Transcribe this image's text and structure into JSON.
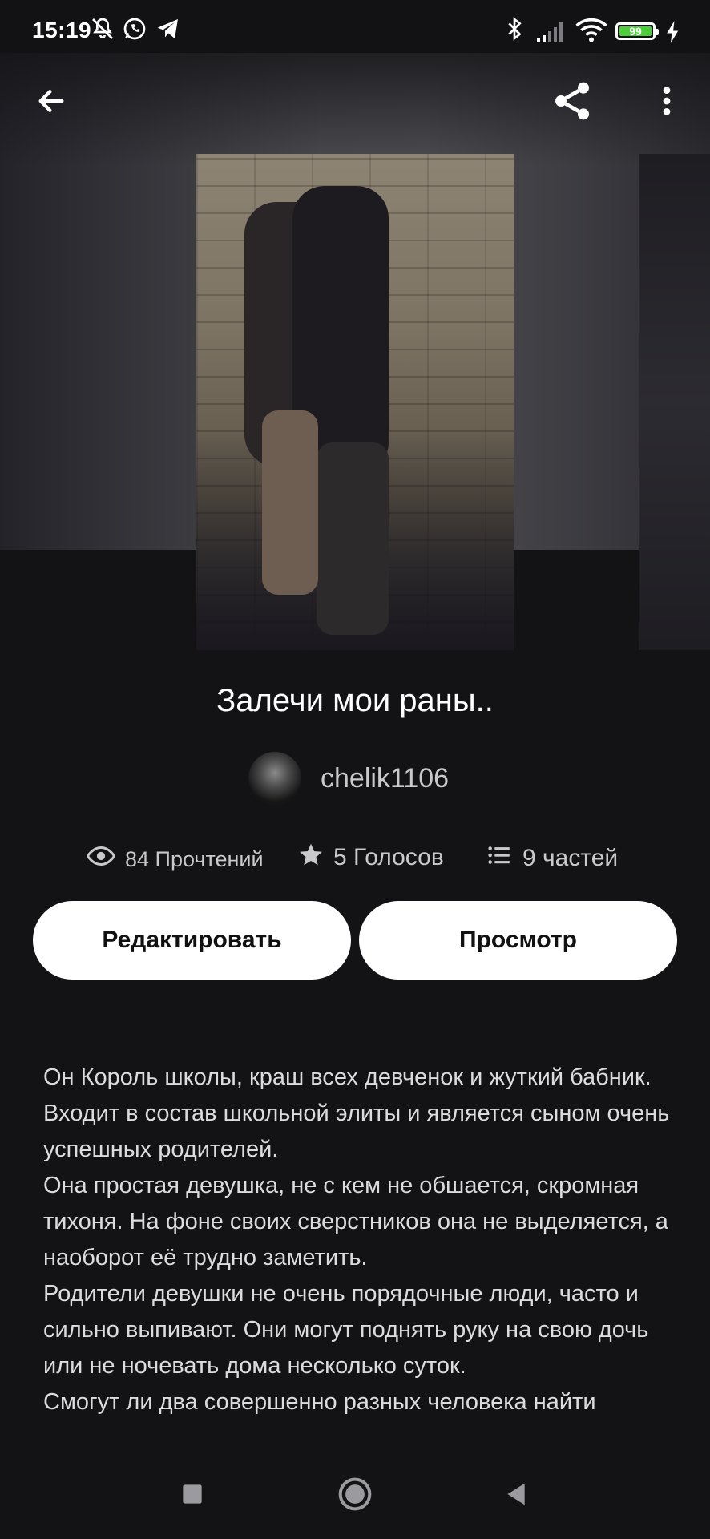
{
  "status_bar": {
    "time": "15:19",
    "battery": "99",
    "icons": [
      "bell-off-icon",
      "whatsapp-icon",
      "telegram-icon",
      "bluetooth-icon",
      "signal-icon",
      "wifi-icon",
      "battery-icon",
      "charging-icon"
    ]
  },
  "toolbar": {
    "back_icon": "arrow-left-icon",
    "share_icon": "share-icon",
    "more_icon": "more-vertical-icon"
  },
  "story": {
    "title": "Залечи мои раны..",
    "author": "chelik1106",
    "reads": "84 Прочтений",
    "votes": "5 Голосов",
    "parts": "9 частей"
  },
  "actions": {
    "edit_label": "Редактировать",
    "view_label": "Просмотр"
  },
  "description": {
    "paragraphs": [
      "Он Король школы, краш всех девченок и жуткий бабник. Входит в состав школьной элиты и является сыном очень успешных родителей.",
      "Она простая девушка, не с кем не обшается, скромная тихоня. На фоне своих сверстников она не выделяется, а наоборот её трудно заметить.",
      "Родители девушки не очень порядочные люди, часто и сильно выпивают. Они могут поднять руку на свою дочь или не ночевать дома несколько суток.",
      "Смогут ли два совершенно разных человека найти"
    ]
  },
  "navbar": {
    "items": [
      "recents-square-icon",
      "home-circle-icon",
      "back-triangle-icon"
    ]
  },
  "colors": {
    "background": "#131215",
    "button_bg": "#ffffff",
    "text_secondary": "#c9c9cc",
    "battery": "#4ccd3a"
  }
}
